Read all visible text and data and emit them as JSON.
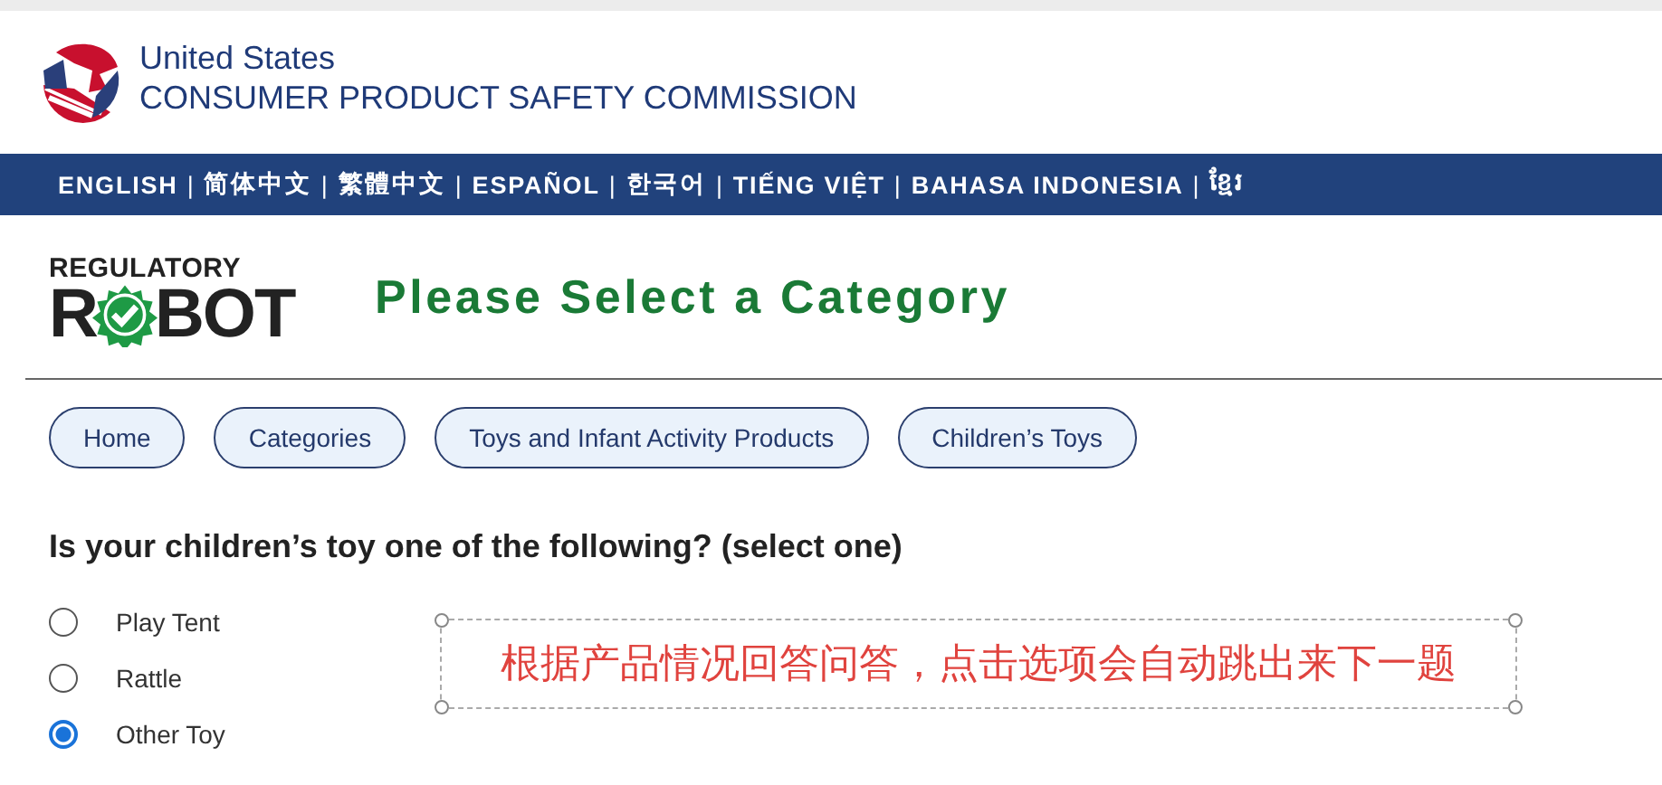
{
  "agency": {
    "line_1": "United States",
    "line_2": "CONSUMER PRODUCT SAFETY COMMISSION"
  },
  "language_bar": [
    {
      "kind": "link",
      "label": "ENGLISH"
    },
    {
      "kind": "separator",
      "label": "|"
    },
    {
      "kind": "link",
      "label": "简体中文"
    },
    {
      "kind": "separator",
      "label": "|"
    },
    {
      "kind": "link",
      "label": "繁體中文"
    },
    {
      "kind": "separator",
      "label": "|"
    },
    {
      "kind": "link",
      "label": "ESPAÑOL"
    },
    {
      "kind": "separator",
      "label": "|"
    },
    {
      "kind": "link",
      "label": "한국어"
    },
    {
      "kind": "separator",
      "label": "|"
    },
    {
      "kind": "link",
      "label": "TIẾNG VIỆT"
    },
    {
      "kind": "separator",
      "label": "|"
    },
    {
      "kind": "link",
      "label": "BAHASA INDONESIA"
    },
    {
      "kind": "separator",
      "label": "|"
    },
    {
      "kind": "link",
      "label": "ខ្មែរ"
    }
  ],
  "robot_logo": {
    "top": "REGULATORY",
    "left": "R",
    "right": "BOT"
  },
  "page_title": "Please Select a Category",
  "breadcrumbs": [
    "Home",
    "Categories",
    "Toys and Infant Activity Products",
    "Children’s Toys"
  ],
  "question": "Is your children’s toy one of the following? (select one)",
  "options": [
    {
      "label": "Play Tent",
      "selected": false
    },
    {
      "label": "Rattle",
      "selected": false
    },
    {
      "label": "Other Toy",
      "selected": true
    }
  ],
  "annotation": "根据产品情况回答问答，点击选项会自动跳出来下一题"
}
